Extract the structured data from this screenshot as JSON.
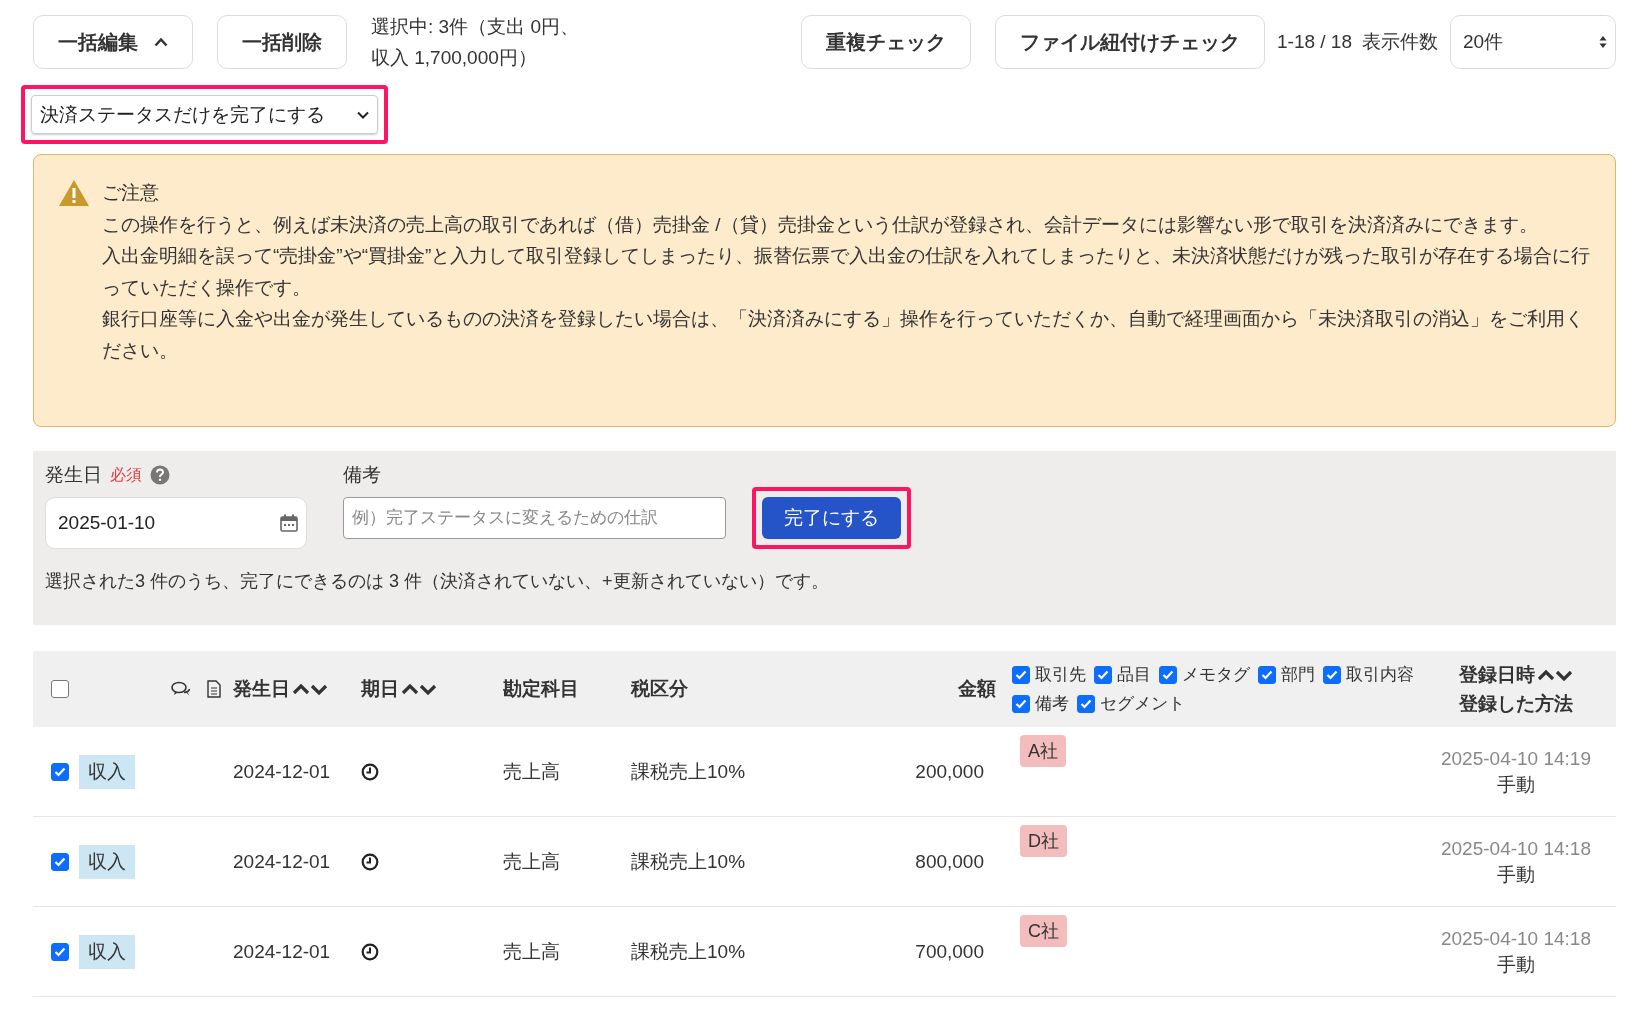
{
  "toolbar": {
    "bulk_edit": {
      "label": "一括編集",
      "expanded": true
    },
    "bulk_delete": "一括削除",
    "selection_summary": [
      "選択中: 3件（支出 0円、",
      "収入 1,700,000円）"
    ],
    "duplicate_check": "重複チェック",
    "file_link_check": "ファイル紐付けチェック",
    "range": "1-18 / 18",
    "page_size_label": "表示件数",
    "page_size": "20件"
  },
  "action_select": {
    "value": "決済ステータスだけを完了にする",
    "highlighted": true
  },
  "notice": {
    "title": "ご注意",
    "lines": [
      "この操作を行うと、例えば未決済の売上高の取引であれば（借）売掛金 /（貸）売掛金という仕訳が登録され、会計データには影響ない形で取引を決済済みにできます。",
      "入出金明細を誤って“売掛金”や“買掛金”と入力して取引登録してしまったり、振替伝票で入出金の仕訳を入れてしまったりと、未決済状態だけが残った取引が存在する場合に行っていただく操作です。",
      "銀行口座等に入金や出金が発生しているものの決済を登録したい場合は、「決済済みにする」操作を行っていただくか、自動で経理画面から「未決済取引の消込」をご利用ください。"
    ]
  },
  "form": {
    "date_label": "発生日",
    "required": "必須",
    "date_value": "2025-01-10",
    "memo_label": "備考",
    "memo_placeholder": "例）完了ステータスに変えるための仕訳",
    "submit": {
      "label": "完了にする",
      "highlighted": true
    },
    "summary": "選択された3 件のうち、完了にできるのは 3 件（決済されていない、+更新されていない）です。"
  },
  "table": {
    "select_all": false,
    "columns": {
      "date": "発生日",
      "due": "期日",
      "account": "勘定科目",
      "tax": "税区分",
      "amount": "金額",
      "registered": "登録日時",
      "method": "登録した方法"
    },
    "tag_toggles": [
      {
        "label": "取引先",
        "checked": true
      },
      {
        "label": "品目",
        "checked": true
      },
      {
        "label": "メモタグ",
        "checked": true
      },
      {
        "label": "部門",
        "checked": true
      },
      {
        "label": "取引内容",
        "checked": true
      },
      {
        "label": "備考",
        "checked": true
      },
      {
        "label": "セグメント",
        "checked": true
      }
    ],
    "rows": [
      {
        "selected": true,
        "type": "収入",
        "date": "2024-12-01",
        "account": "売上高",
        "tax": "課税売上10%",
        "amount": "200,000",
        "partner": "A社",
        "registered": "2025-04-10 14:19",
        "method": "手動"
      },
      {
        "selected": true,
        "type": "収入",
        "date": "2024-12-01",
        "account": "売上高",
        "tax": "課税売上10%",
        "amount": "800,000",
        "partner": "D社",
        "registered": "2025-04-10 14:18",
        "method": "手動"
      },
      {
        "selected": true,
        "type": "収入",
        "date": "2024-12-01",
        "account": "売上高",
        "tax": "課税売上10%",
        "amount": "700,000",
        "partner": "C社",
        "registered": "2025-04-10 14:18",
        "method": "手動"
      }
    ]
  }
}
